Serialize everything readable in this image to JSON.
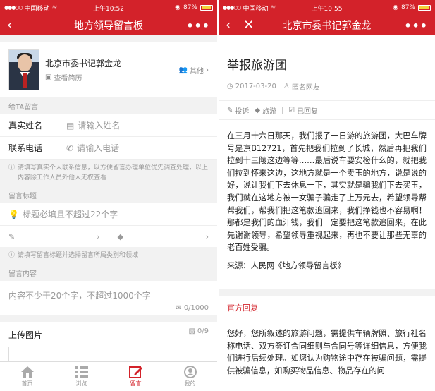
{
  "status_left": {
    "carrier": "中国移动",
    "time": "上午10:52",
    "battery": "87%",
    "battery_level": 0.87
  },
  "status_right": {
    "carrier": "中国移动",
    "time": "上午10:55",
    "battery": "87%",
    "battery_level": 0.87
  },
  "left": {
    "nav_title": "地方领导留言板",
    "more": "•••",
    "profile": {
      "name": "北京市委书记郭金龙",
      "resume": "查看简历",
      "other": "其他"
    },
    "section_leave_msg": "给TA留言",
    "name_label": "真实姓名",
    "name_placeholder": "请输入姓名",
    "phone_label": "联系电话",
    "phone_placeholder": "请输入电话",
    "privacy_note": "请填写真实个人联系信息，以方便留言办理单位优先调查处理，以上内容除工作人员外他人无权查看",
    "section_title": "留言标题",
    "title_placeholder": "标题必填且不超过22个字",
    "tags_note": "请填写留言标题并选择留言所属类别和领域",
    "section_content": "留言内容",
    "content_placeholder": "内容不少于20个字，不超过1000个字",
    "content_counter": "0/1000",
    "upload_label": "上传图片",
    "upload_counter": "0/9",
    "tabs": [
      {
        "label": "首页",
        "icon": "home-icon"
      },
      {
        "label": "浏览",
        "icon": "list-icon"
      },
      {
        "label": "留言",
        "icon": "edit-icon"
      },
      {
        "label": "我的",
        "icon": "user-icon"
      }
    ]
  },
  "right": {
    "nav_title": "北京市委书记郭金龙",
    "more": "•••",
    "article_title": "举报旅游团",
    "date": "2017-03-20",
    "author": "匿名网友",
    "tags": {
      "category": "投诉",
      "field": "旅游",
      "status": "已回复"
    },
    "body": "在三月十六日那天，我们报了一日游的旅游团，大巴车牌号是京B12721，首先把我们拉到了长城，然后再把我们拉到十三陵这边等等……最后说车要安检什么的，就把我们拉到怀来这边，这地方就是一个卖玉的地方，说是说的好，说让我们下去休息一下，其实就是骗我们下去买玉，我们就在这地方被一女骗子骗走了上万元去，希望领导帮帮我们，帮我们把这笔款追回来，我们挣钱也不容易啊！那都是我们的血汗钱，我们一定要把这笔款追回来，在此先谢谢领导，希望领导重视起来，再也不要让那些无辜的老百姓受骗。",
    "source": "来源：人民网《地方领导留言板》",
    "official_label": "官方回复",
    "reply": "您好，您所叙述的旅游问题，需提供车辆牌照、旅行社名称电话、双方签订合同细则与合同号等详细信息，方便我们进行后续处理。如您认为购物途中存在被骗问题，需提供被骗信息，如购买物品信息、物品存在的问"
  },
  "colors": {
    "brand_red": "#d3222a",
    "background": "#f2f2f2"
  }
}
